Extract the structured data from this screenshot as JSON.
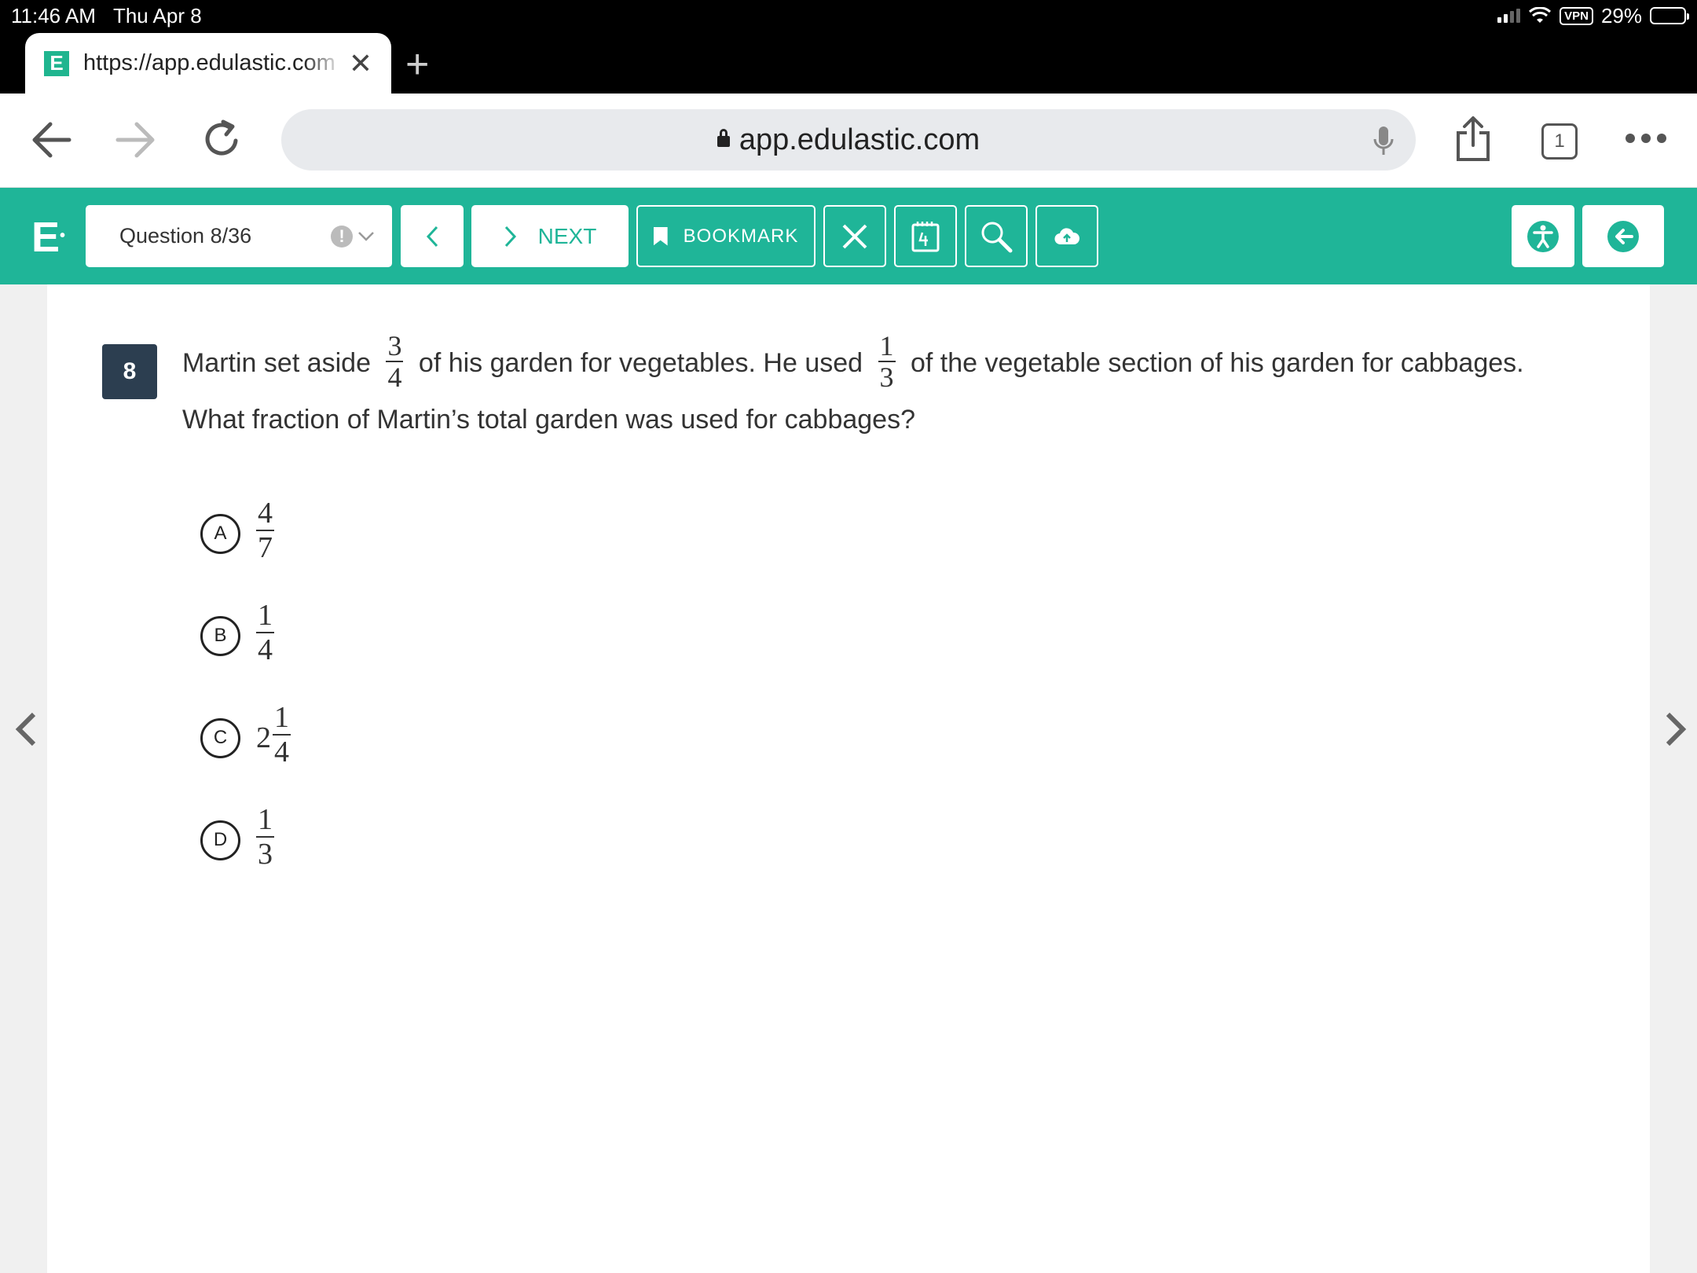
{
  "status": {
    "time": "11:46 AM",
    "date": "Thu Apr 8",
    "vpn": "VPN",
    "battery": "29%"
  },
  "browser": {
    "tab_title": "https://app.edulastic.com",
    "tab_favicon": "E",
    "url": "app.edulastic.com",
    "tab_count": "1"
  },
  "appbar": {
    "brand": "E",
    "question_selector": "Question 8/36",
    "next_label": "NEXT",
    "bookmark_label": "BOOKMARK"
  },
  "question": {
    "number": "8",
    "text_part1": "Martin set aside",
    "frac1": {
      "num": "3",
      "den": "4"
    },
    "text_part2": "of his garden for vegetables. He used",
    "frac2": {
      "num": "1",
      "den": "3"
    },
    "text_part3": "of the vegetable section of his garden for cabbages. What fraction of Martin’s total garden was used for cabbages?"
  },
  "options": [
    {
      "letter": "A",
      "whole": "",
      "num": "4",
      "den": "7"
    },
    {
      "letter": "B",
      "whole": "",
      "num": "1",
      "den": "4"
    },
    {
      "letter": "C",
      "whole": "2",
      "num": "1",
      "den": "4"
    },
    {
      "letter": "D",
      "whole": "",
      "num": "1",
      "den": "3"
    }
  ],
  "colors": {
    "accent": "#1fb598",
    "badge": "#2c3e50"
  },
  "icons": [
    "back-arrow-icon",
    "forward-arrow-icon",
    "reload-icon",
    "lock-icon",
    "mic-icon",
    "share-icon",
    "more-icon",
    "chevron-left-icon",
    "chevron-right-icon",
    "bookmark-icon",
    "close-icon",
    "calculator-icon",
    "magnifier-icon",
    "cloud-upload-icon",
    "accessibility-icon",
    "exit-icon"
  ]
}
